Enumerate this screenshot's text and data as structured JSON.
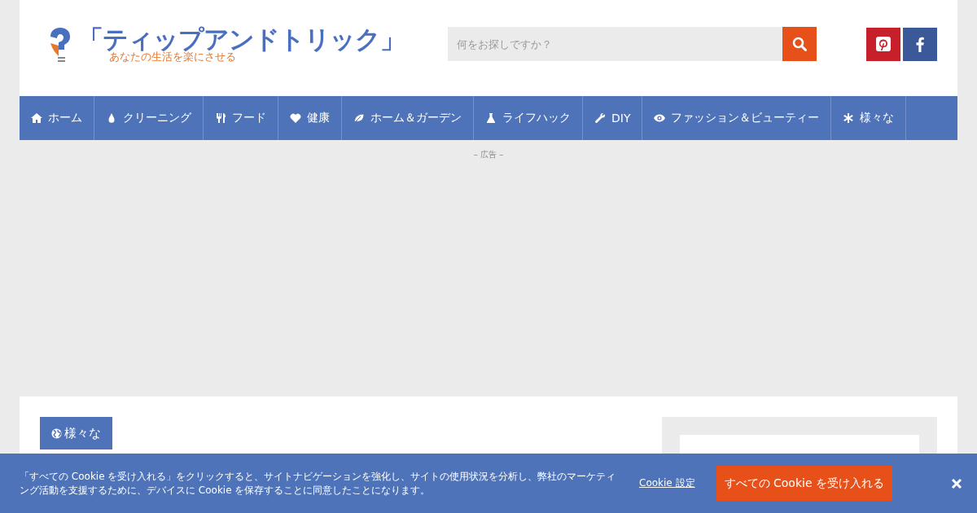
{
  "header": {
    "site_title": "「ティップアンドトリック」",
    "tagline": "あなたの生活を楽にさせる",
    "search": {
      "placeholder": "何をお探しですか？"
    }
  },
  "nav": [
    {
      "label": "ホーム"
    },
    {
      "label": "クリーニング"
    },
    {
      "label": "フード"
    },
    {
      "label": "健康"
    },
    {
      "label": "ホーム＆ガーデン"
    },
    {
      "label": "ライフハック"
    },
    {
      "label": "DIY"
    },
    {
      "label": "ファッション＆ビューティー"
    },
    {
      "label": "様々な"
    }
  ],
  "ad_label": "– 広告 –",
  "category_badge": "様々な",
  "cookie_banner": {
    "message": "「すべての Cookie を受け入れる」をクリックすると、サイトナビゲーションを強化し、サイトの使用状況を分析し、弊社のマーケティング活動を支援するために、デバイスに Cookie を保存することに同意したことになります。",
    "settings_link": "Cookie 設定",
    "accept_button": "すべての Cookie を受け入れる"
  }
}
